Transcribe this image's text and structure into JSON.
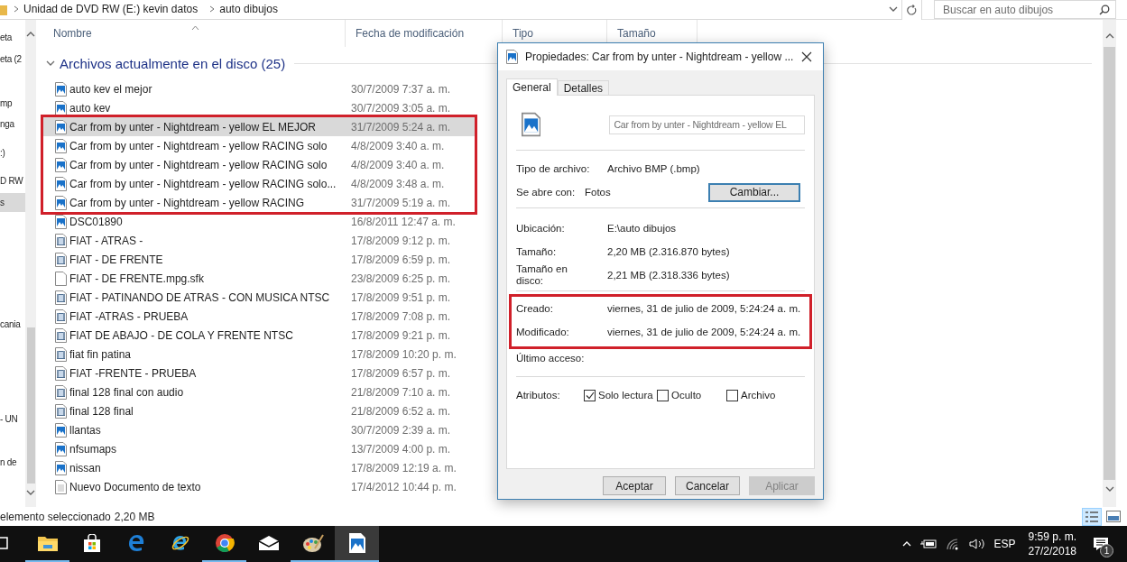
{
  "address_bar": {
    "crumbs": [
      "Unidad de DVD RW (E:) kevin datos",
      "auto dibujos"
    ]
  },
  "search": {
    "placeholder": "Buscar en auto dibujos"
  },
  "nav_pane": {
    "items": [
      {
        "label": "eta",
        "selected": false
      },
      {
        "label": "eta (2",
        "selected": false
      },
      {
        "label": "mp",
        "selected": false
      },
      {
        "label": "nga",
        "selected": false
      },
      {
        "label": ":)",
        "selected": false
      },
      {
        "label": "D RW",
        "selected": false
      },
      {
        "label": "s",
        "selected": true
      },
      {
        "label": "cania",
        "selected": false
      },
      {
        "label": "- UN",
        "selected": false
      },
      {
        "label": "n de",
        "selected": false
      }
    ]
  },
  "columns": [
    "Nombre",
    "Fecha de modificación",
    "Tipo",
    "Tamaño"
  ],
  "group": {
    "label": "Archivos actualmente en el disco (25)",
    "expanded": true
  },
  "rows": [
    {
      "kind": "image",
      "name": "auto kev el mejor",
      "date": "30/7/2009 7:37 a. m.",
      "selected": false,
      "marked": false
    },
    {
      "kind": "image",
      "name": "auto kev",
      "date": "30/7/2009 3:05 a. m.",
      "selected": false,
      "marked": false
    },
    {
      "kind": "image",
      "name": "Car from by unter - Nightdream - yellow EL MEJOR",
      "date": "31/7/2009 5:24 a. m.",
      "selected": true,
      "marked": true
    },
    {
      "kind": "image",
      "name": "Car from by unter - Nightdream - yellow RACING solo",
      "date": "4/8/2009 3:40 a. m.",
      "selected": false,
      "marked": true
    },
    {
      "kind": "image",
      "name": "Car from by unter - Nightdream - yellow RACING solo",
      "date": "4/8/2009 3:40 a. m.",
      "selected": false,
      "marked": true
    },
    {
      "kind": "image",
      "name": "Car from by unter - Nightdream - yellow RACING solo...",
      "date": "4/8/2009 3:48 a. m.",
      "selected": false,
      "marked": true
    },
    {
      "kind": "image",
      "name": "Car from by unter - Nightdream - yellow RACING",
      "date": "31/7/2009 5:19 a. m.",
      "selected": false,
      "marked": true
    },
    {
      "kind": "image",
      "name": "DSC01890",
      "date": "16/8/2011 12:47 a. m.",
      "selected": false,
      "marked": false
    },
    {
      "kind": "video",
      "name": "FIAT - ATRAS -",
      "date": "17/8/2009 9:12 p. m.",
      "selected": false,
      "marked": false
    },
    {
      "kind": "video",
      "name": "FIAT - DE FRENTE",
      "date": "17/8/2009 6:59 p. m.",
      "selected": false,
      "marked": false
    },
    {
      "kind": "file",
      "name": "FIAT - DE FRENTE.mpg.sfk",
      "date": "23/8/2009 6:25 p. m.",
      "selected": false,
      "marked": false
    },
    {
      "kind": "video",
      "name": "FIAT - PATINANDO DE ATRAS - CON MUSICA NTSC",
      "date": "17/8/2009 9:51 p. m.",
      "selected": false,
      "marked": false
    },
    {
      "kind": "video",
      "name": "FIAT -ATRAS - PRUEBA",
      "date": "17/8/2009 7:08 p. m.",
      "selected": false,
      "marked": false
    },
    {
      "kind": "video",
      "name": "FIAT DE ABAJO - DE COLA Y FRENTE NTSC",
      "date": "17/8/2009 9:21 p. m.",
      "selected": false,
      "marked": false
    },
    {
      "kind": "video",
      "name": "fiat fin patina",
      "date": "17/8/2009 10:20 p. m.",
      "selected": false,
      "marked": false
    },
    {
      "kind": "video",
      "name": "FIAT -FRENTE - PRUEBA",
      "date": "17/8/2009 6:57 p. m.",
      "selected": false,
      "marked": false
    },
    {
      "kind": "video",
      "name": "final 128 final con audio",
      "date": "21/8/2009 7:10 a. m.",
      "selected": false,
      "marked": false
    },
    {
      "kind": "video",
      "name": "final 128 final",
      "date": "21/8/2009 6:52 a. m.",
      "selected": false,
      "marked": false
    },
    {
      "kind": "image",
      "name": "llantas",
      "date": "30/7/2009 2:39 a. m.",
      "selected": false,
      "marked": false
    },
    {
      "kind": "image",
      "name": "nfsumaps",
      "date": "13/7/2009 4:00 p. m.",
      "selected": false,
      "marked": false
    },
    {
      "kind": "image",
      "name": "nissan",
      "date": "17/8/2009 12:19 a. m.",
      "selected": false,
      "marked": false
    },
    {
      "kind": "text",
      "name": "Nuevo Documento de texto",
      "date": "17/4/2012 10:44 p. m.",
      "selected": false,
      "marked": false
    }
  ],
  "status_bar": {
    "selection": "elemento seleccionado",
    "size": "2,20 MB",
    "views": [
      {
        "kind": "details",
        "selected": true
      },
      {
        "kind": "large_icons",
        "selected": false
      }
    ]
  },
  "dialog": {
    "title": "Propiedades: Car from by unter - Nightdream - yellow ...",
    "tabs": [
      {
        "label": "General",
        "selected": true
      },
      {
        "label": "Detalles",
        "selected": false
      }
    ],
    "file_name": "Car from by unter - Nightdream - yellow EL",
    "sections": [
      [
        {
          "kind": "text",
          "label": "Tipo de archivo:",
          "value": "Archivo BMP (.bmp)",
          "marked": false
        },
        {
          "kind": "app",
          "label": "Se abre con:",
          "value": "Fotos",
          "button": "Cambiar...",
          "marked": false
        }
      ],
      [
        {
          "kind": "text",
          "label": "Ubicación:",
          "value": "E:\\auto dibujos",
          "marked": false
        },
        {
          "kind": "text",
          "label": "Tamaño:",
          "value": "2,20 MB (2.316.870 bytes)",
          "marked": false
        },
        {
          "kind": "text",
          "label": "Tamaño en\ndisco:",
          "value": "2,21 MB (2.318.336 bytes)",
          "marked": false
        }
      ],
      [
        {
          "kind": "text",
          "label": "Creado:",
          "value": "viernes, 31 de julio de 2009, 5:24:24 a. m.",
          "marked": true
        },
        {
          "kind": "text",
          "label": "Modificado:",
          "value": "viernes, 31 de julio de 2009, 5:24:24 a. m.",
          "marked": true
        },
        {
          "kind": "text",
          "label": "Último acceso:",
          "marked": false
        }
      ]
    ],
    "attributes": {
      "label": "Atributos:",
      "items": [
        {
          "label": "Solo lectura",
          "checked": true
        },
        {
          "label": "Oculto",
          "checked": false
        },
        {
          "label": "Archivo",
          "checked": false
        }
      ]
    },
    "buttons": [
      {
        "label": "Aceptar",
        "disabled": false
      },
      {
        "label": "Cancelar",
        "disabled": false
      },
      {
        "label": "Aplicar",
        "disabled": true
      }
    ]
  },
  "taskbar": {
    "apps": [
      {
        "kind": "task_view",
        "running": false,
        "selected": false
      },
      {
        "kind": "explorer",
        "running": true,
        "selected": false
      },
      {
        "kind": "store",
        "running": false,
        "selected": false
      },
      {
        "kind": "edge",
        "running": false,
        "selected": false
      },
      {
        "kind": "ie",
        "running": false,
        "selected": false
      },
      {
        "kind": "chrome",
        "running": true,
        "selected": false
      },
      {
        "kind": "mail",
        "running": false,
        "selected": false
      },
      {
        "kind": "paint",
        "running": true,
        "selected": false
      },
      {
        "kind": "photos",
        "running": true,
        "selected": true
      }
    ],
    "language": "ESP",
    "time": "9:59 p. m.",
    "date": "27/2/2018",
    "notifications": "1"
  }
}
